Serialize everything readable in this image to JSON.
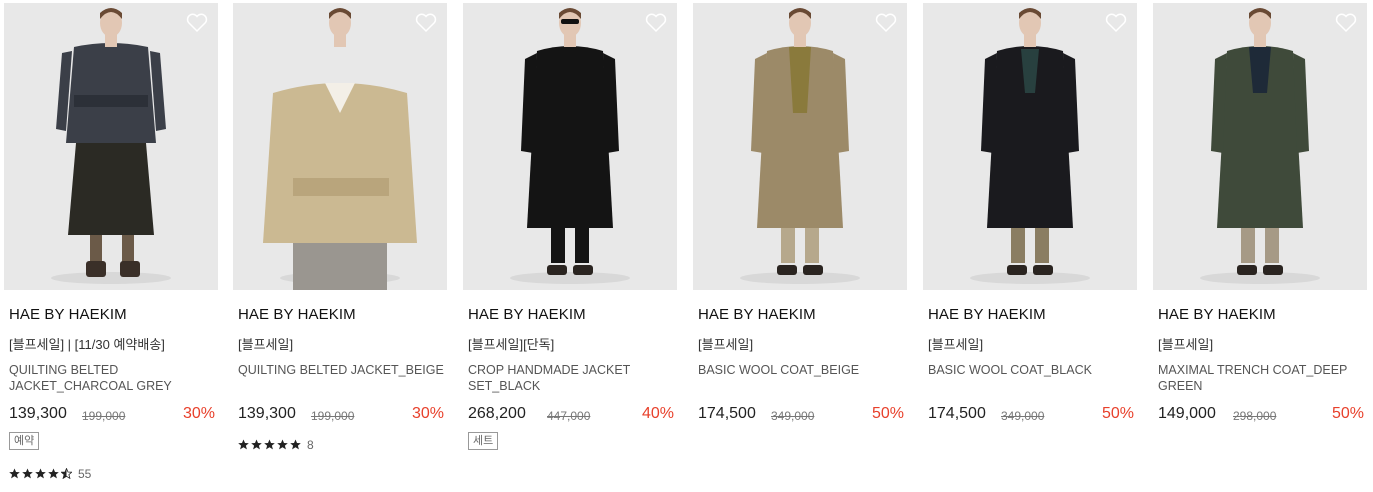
{
  "products": [
    {
      "brand": "HAE BY HAEKIM",
      "tag": "[블프세일] | [11/30 예약배송]",
      "name": "QUILTING BELTED JACKET_CHARCOAL GREY",
      "price": "139,300",
      "original_price": "199,000",
      "discount": "30%",
      "badge": "예약",
      "rating_stars": 4.5,
      "review_count": "55",
      "coat_color": "#3b3f48",
      "bottom_color": "#2b2a24"
    },
    {
      "brand": "HAE BY HAEKIM",
      "tag": "[블프세일]",
      "name": "QUILTING BELTED JACKET_BEIGE",
      "price": "139,300",
      "original_price": "199,000",
      "discount": "30%",
      "rating_stars": 5,
      "review_count": "8",
      "coat_color": "#cbb992",
      "bottom_color": "#9a9690"
    },
    {
      "brand": "HAE BY HAEKIM",
      "tag": "[블프세일][단독]",
      "name": "CROP HANDMADE JACKET SET_BLACK",
      "price": "268,200",
      "original_price": "447,000",
      "discount": "40%",
      "badge": "세트",
      "coat_color": "#141414",
      "bottom_color": "#141414"
    },
    {
      "brand": "HAE BY HAEKIM",
      "tag": "[블프세일]",
      "name": "BASIC WOOL COAT_BEIGE",
      "price": "174,500",
      "original_price": "349,000",
      "discount": "50%",
      "coat_color": "#9c8a68",
      "bottom_color": "#b6a88c"
    },
    {
      "brand": "HAE BY HAEKIM",
      "tag": "[블프세일]",
      "name": "BASIC WOOL COAT_BLACK",
      "price": "174,500",
      "original_price": "349,000",
      "discount": "50%",
      "coat_color": "#1a1a1e",
      "bottom_color": "#8a7d62"
    },
    {
      "brand": "HAE BY HAEKIM",
      "tag": "[블프세일]",
      "name": "MAXIMAL TRENCH COAT_DEEP GREEN",
      "price": "149,000",
      "original_price": "298,000",
      "discount": "50%",
      "coat_color": "#3f4a3a",
      "bottom_color": "#a69a86"
    }
  ],
  "colors": {
    "discount": "#e8402b",
    "background": "#e8e8e8"
  },
  "icons": {
    "wishlist": "heart-outline-icon",
    "rating": "star-icon"
  }
}
